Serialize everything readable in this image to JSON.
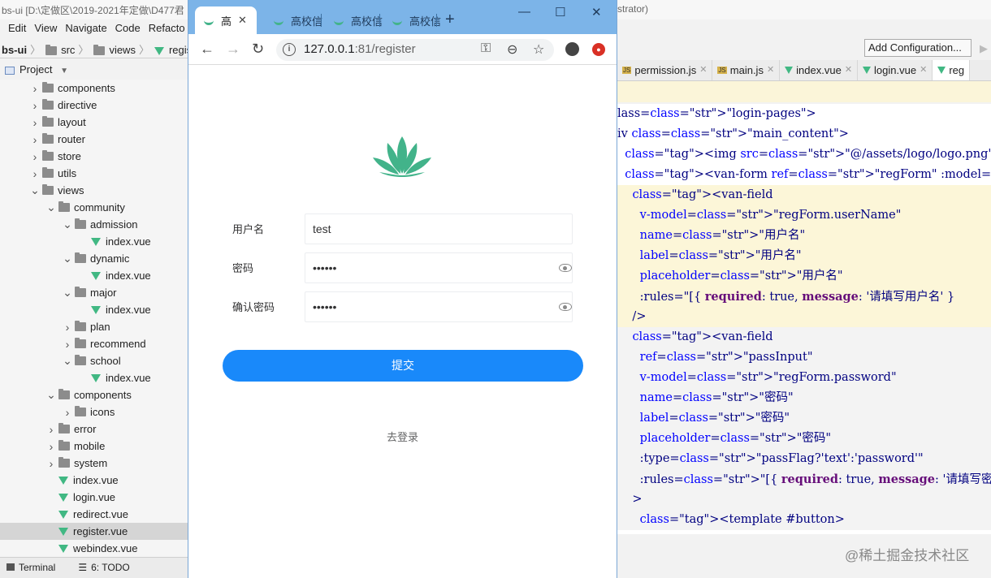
{
  "ide": {
    "title": "bs-ui [D:\\定做区\\2019-2021年定做\\D477君",
    "title_right": "strator)",
    "menu": [
      "Edit",
      "View",
      "Navigate",
      "Code",
      "Refacto"
    ],
    "breadcrumb": [
      "bs-ui",
      "src",
      "views",
      "register.v"
    ],
    "project_label": "Project",
    "tree": [
      {
        "label": "components",
        "kind": "folder",
        "depth": 1,
        "state": "closed"
      },
      {
        "label": "directive",
        "kind": "folder",
        "depth": 1,
        "state": "closed"
      },
      {
        "label": "layout",
        "kind": "folder",
        "depth": 1,
        "state": "closed"
      },
      {
        "label": "router",
        "kind": "folder",
        "depth": 1,
        "state": "closed"
      },
      {
        "label": "store",
        "kind": "folder",
        "depth": 1,
        "state": "closed"
      },
      {
        "label": "utils",
        "kind": "folder",
        "depth": 1,
        "state": "closed"
      },
      {
        "label": "views",
        "kind": "folder",
        "depth": 1,
        "state": "open"
      },
      {
        "label": "community",
        "kind": "folder",
        "depth": 2,
        "state": "open"
      },
      {
        "label": "admission",
        "kind": "folder",
        "depth": 3,
        "state": "open"
      },
      {
        "label": "index.vue",
        "kind": "vue",
        "depth": 4
      },
      {
        "label": "dynamic",
        "kind": "folder",
        "depth": 3,
        "state": "open"
      },
      {
        "label": "index.vue",
        "kind": "vue",
        "depth": 4
      },
      {
        "label": "major",
        "kind": "folder",
        "depth": 3,
        "state": "open"
      },
      {
        "label": "index.vue",
        "kind": "vue",
        "depth": 4
      },
      {
        "label": "plan",
        "kind": "folder",
        "depth": 3,
        "state": "closed"
      },
      {
        "label": "recommend",
        "kind": "folder",
        "depth": 3,
        "state": "closed"
      },
      {
        "label": "school",
        "kind": "folder",
        "depth": 3,
        "state": "open"
      },
      {
        "label": "index.vue",
        "kind": "vue",
        "depth": 4
      },
      {
        "label": "components",
        "kind": "folder",
        "depth": 2,
        "state": "open"
      },
      {
        "label": "icons",
        "kind": "folder",
        "depth": 3,
        "state": "closed"
      },
      {
        "label": "error",
        "kind": "folder",
        "depth": 2,
        "state": "closed"
      },
      {
        "label": "mobile",
        "kind": "folder",
        "depth": 2,
        "state": "closed"
      },
      {
        "label": "system",
        "kind": "folder",
        "depth": 2,
        "state": "closed"
      },
      {
        "label": "index.vue",
        "kind": "vue",
        "depth": 2
      },
      {
        "label": "login.vue",
        "kind": "vue",
        "depth": 2
      },
      {
        "label": "redirect.vue",
        "kind": "vue",
        "depth": 2
      },
      {
        "label": "register.vue",
        "kind": "vue",
        "depth": 2,
        "selected": true
      },
      {
        "label": "webindex.vue",
        "kind": "vue",
        "depth": 2
      }
    ],
    "bottom_tools": [
      "Terminal",
      "6: TODO"
    ],
    "add_config": "Add Configuration...",
    "editor_tabs": [
      {
        "label": "permission.js",
        "kind": "js"
      },
      {
        "label": "main.js",
        "kind": "js"
      },
      {
        "label": "index.vue",
        "kind": "vue"
      },
      {
        "label": "login.vue",
        "kind": "vue"
      },
      {
        "label": "reg",
        "kind": "vue",
        "active": true
      }
    ],
    "code_lines": [
      "lass=\"login-pages\">",
      "iv class=\"main_content\">",
      "  <img src=\"@/assets/logo/logo.png\" alt=\"\" class=\"logo\">",
      "  <van-form ref=\"regForm\" :model=\"regForm\">",
      "    <van-field",
      "      v-model=\"regForm.userName\"",
      "      name=\"用户名\"",
      "      label=\"用户名\"",
      "      placeholder=\"用户名\"",
      "      :rules=\"[{ required: true, message: '请填写用户名' }",
      "    />",
      "    <van-field",
      "      ref=\"passInput\"",
      "      v-model=\"regForm.password\"",
      "      name=\"密码\"",
      "      label=\"密码\"",
      "      placeholder=\"密码\"",
      "      :type=\"passFlag?'text':'password'\"",
      "      :rules=\"[{ required: true, message: '请填写密码' }]\"",
      "    >",
      "      <template #button>"
    ],
    "watermark": "@稀土掘金技术社区"
  },
  "browser": {
    "tabs": [
      {
        "label": "高",
        "active": true
      },
      {
        "label": "高校信"
      },
      {
        "label": "高校信"
      },
      {
        "label": "高校信"
      }
    ],
    "close_glyph": "✕",
    "new_tab_glyph": "+",
    "url_host": "127.0.0.1",
    "url_rest": ":81/register",
    "info_glyph": "i"
  },
  "page": {
    "fields": [
      {
        "label": "用户名",
        "value": "test",
        "type": "text"
      },
      {
        "label": "密码",
        "value": "••••••",
        "type": "password"
      },
      {
        "label": "确认密码",
        "value": "••••••",
        "type": "password"
      }
    ],
    "submit_label": "提交",
    "login_link": "去登录"
  },
  "colors": {
    "accent": "#1989fa",
    "logo": "#42b38a",
    "browser_chrome": "#7cb4e8"
  }
}
